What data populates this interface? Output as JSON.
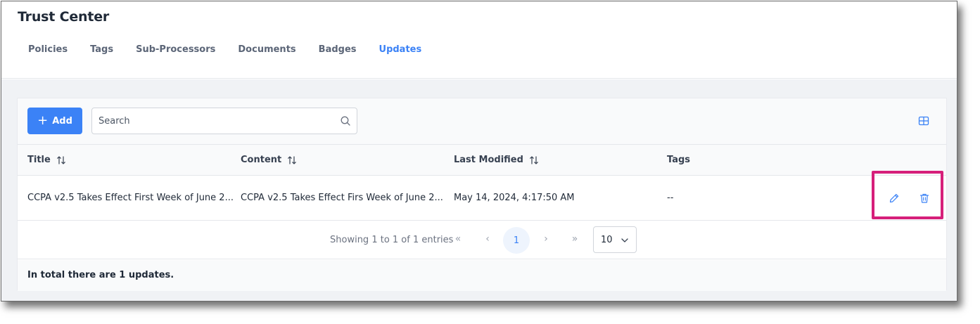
{
  "header": {
    "title": "Trust Center",
    "tabs": [
      {
        "label": "Policies",
        "active": false
      },
      {
        "label": "Tags",
        "active": false
      },
      {
        "label": "Sub-Processors",
        "active": false
      },
      {
        "label": "Documents",
        "active": false
      },
      {
        "label": "Badges",
        "active": false
      },
      {
        "label": "Updates",
        "active": true
      }
    ]
  },
  "toolbar": {
    "add_label": "Add",
    "search_placeholder": "Search",
    "search_icon": "search-icon",
    "layout_icon": "grid-layout-icon"
  },
  "table": {
    "columns": [
      {
        "label": "Title",
        "sortable": true
      },
      {
        "label": "Content",
        "sortable": true
      },
      {
        "label": "Last Modified",
        "sortable": true
      },
      {
        "label": "Tags",
        "sortable": false
      }
    ],
    "rows": [
      {
        "title": "CCPA v2.5 Takes Effect First Week of June 2...",
        "content": "CCPA v2.5 Takes Effect Firs Week of June 2...",
        "last_modified": "May 14, 2024, 4:17:50 AM",
        "tags": "--",
        "actions": [
          "edit-icon",
          "trash-icon"
        ]
      }
    ]
  },
  "pagination": {
    "info": "Showing 1 to 1 of 1 entries",
    "first": "«",
    "prev": "‹",
    "current_page": "1",
    "next": "›",
    "last": "»",
    "page_size": "10"
  },
  "footer": {
    "summary": "In total there are 1 updates."
  },
  "colors": {
    "accent": "#3b82f6",
    "highlight": "#d61f7a",
    "background": "#f0f2f5"
  }
}
